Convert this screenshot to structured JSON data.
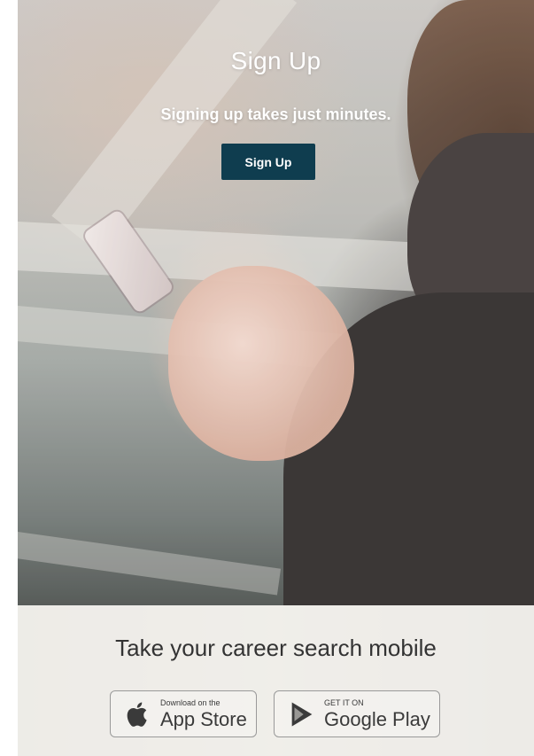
{
  "hero": {
    "title": "Sign Up",
    "subtitle": "Signing up takes just minutes.",
    "button_label": "Sign Up"
  },
  "mobile": {
    "title": "Take your career search mobile",
    "app_store": {
      "small_label": "Download on the",
      "large_label": "App Store",
      "icon": "apple-icon"
    },
    "google_play": {
      "small_label": "GET IT ON",
      "large_label": "Google Play",
      "icon": "google-play-icon"
    }
  },
  "colors": {
    "button_bg": "#0f3d4f",
    "hero_text": "#ffffff",
    "mobile_text": "#333333",
    "badge_border": "#999999"
  }
}
